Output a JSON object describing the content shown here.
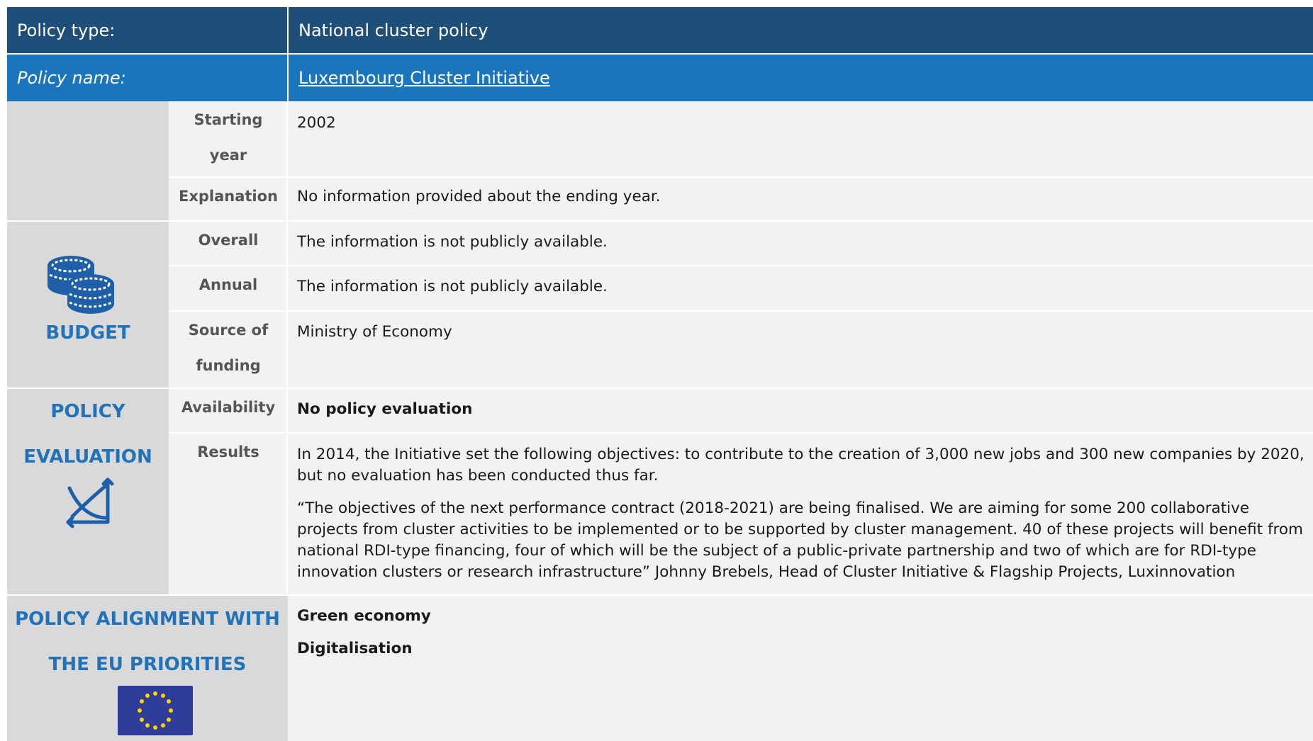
{
  "header": {
    "policy_type_label": "Policy type:",
    "policy_type_value": "National cluster policy",
    "policy_name_label": "Policy name:",
    "policy_name_value": "Luxembourg Cluster Initiative"
  },
  "timeline": {
    "starting_year_label_1": "Starting",
    "starting_year_label_2": "year",
    "starting_year_value": "2002",
    "explanation_label": "Explanation",
    "explanation_value": "No information provided about the ending year."
  },
  "budget": {
    "section_title": "BUDGET",
    "icon": "coins-icon",
    "overall_label": "Overall",
    "overall_value": "The information is not publicly available.",
    "annual_label": "Annual",
    "annual_value": "The information is not publicly available.",
    "source_label_1": "Source of",
    "source_label_2": "funding",
    "source_value": "Ministry of Economy"
  },
  "evaluation": {
    "section_title_1": "POLICY",
    "section_title_2": "EVALUATION",
    "icon": "chart-curve-icon",
    "availability_label": "Availability",
    "availability_value": "No policy evaluation",
    "results_label": "Results",
    "results_para_1": "In 2014, the Initiative set the following objectives: to contribute to the creation of 3,000 new jobs and 300 new companies by 2020, but no evaluation has been conducted thus far.",
    "results_para_2": "“The objectives of the next performance contract (2018-2021) are being finalised. We are aiming for some 200 collaborative projects from cluster activities to be implemented or to be supported by cluster management. 40 of these projects will benefit from national RDI-type financing, four of which will be the subject of a public-private partnership and two of which are for RDI-type innovation clusters or research infrastructure” Johnny Brebels, Head of Cluster Initiative & Flagship Projects, Luxinnovation"
  },
  "alignment": {
    "section_title_1": "POLICY ALIGNMENT WITH",
    "section_title_2": "THE EU PRIORITIES",
    "icon": "eu-flag-icon",
    "items": [
      "Green economy",
      "Digitalisation"
    ]
  },
  "colors": {
    "header_dark": "#1f4e79",
    "header_blue": "#1b75bc",
    "accent": "#2272b8",
    "section_bg": "#d9d9d9",
    "cell_bg": "#f2f2f2"
  }
}
